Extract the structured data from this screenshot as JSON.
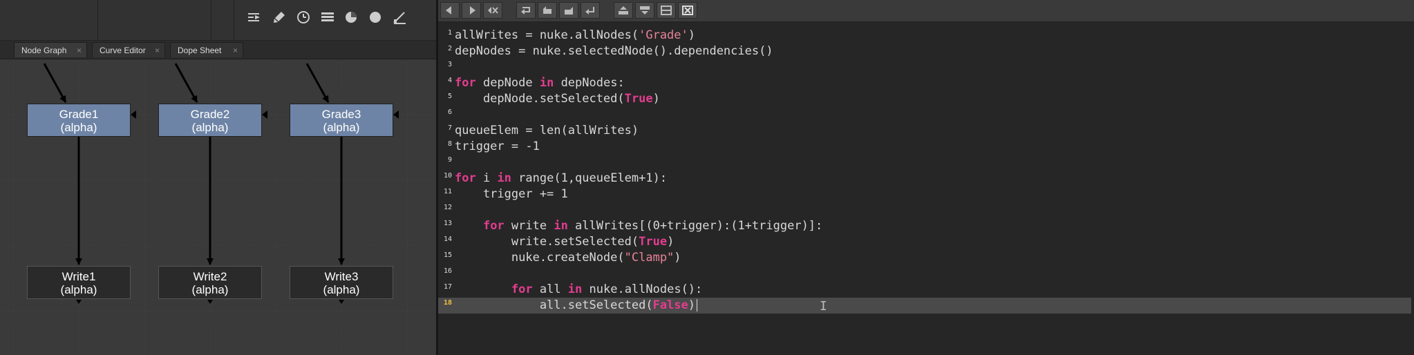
{
  "node_graph_toolbar": {
    "icons": [
      "script-editor-icon",
      "brush-icon",
      "clock-icon",
      "list-icon",
      "pie-icon",
      "circle-icon",
      "probe-icon"
    ]
  },
  "tabs": [
    {
      "label": "Node Graph",
      "close": "×"
    },
    {
      "label": "Curve Editor",
      "close": "×"
    },
    {
      "label": "Dope Sheet",
      "close": "×"
    }
  ],
  "nodes": {
    "grade1": {
      "name": "Grade1",
      "sub": "(alpha)"
    },
    "grade2": {
      "name": "Grade2",
      "sub": "(alpha)"
    },
    "grade3": {
      "name": "Grade3",
      "sub": "(alpha)"
    },
    "write1": {
      "name": "Write1",
      "sub": "(alpha)"
    },
    "write2": {
      "name": "Write2",
      "sub": "(alpha)"
    },
    "write3": {
      "name": "Write3",
      "sub": "(alpha)"
    }
  },
  "script_toolbar": {
    "buttons": [
      "previous-script-icon",
      "next-script-icon",
      "clear-history-icon",
      "source-script-icon",
      "load-script-icon",
      "save-script-icon",
      "run-script-icon",
      "show-input-icon",
      "show-output-icon",
      "show-both-icon",
      "clear-output-icon"
    ]
  },
  "code": {
    "current_line": 18,
    "lines": [
      {
        "n": "1",
        "tokens": [
          [
            "",
            "allWrites = nuke.allNodes("
          ],
          [
            "str",
            "'Grade'"
          ],
          [
            "",
            ")"
          ]
        ]
      },
      {
        "n": "2",
        "tokens": [
          [
            "",
            "depNodes = nuke.selectedNode().dependencies()"
          ]
        ]
      },
      {
        "n": "3",
        "tokens": []
      },
      {
        "n": "4",
        "tokens": [
          [
            "kw",
            "for"
          ],
          [
            "",
            " depNode "
          ],
          [
            "kw",
            "in"
          ],
          [
            "",
            " depNodes:"
          ]
        ]
      },
      {
        "n": "5",
        "tokens": [
          [
            "",
            "    depNode.setSelected("
          ],
          [
            "kw",
            "True"
          ],
          [
            "",
            ")"
          ]
        ]
      },
      {
        "n": "6",
        "tokens": []
      },
      {
        "n": "7",
        "tokens": [
          [
            "",
            "queueElem = len(allWrites)"
          ]
        ]
      },
      {
        "n": "8",
        "tokens": [
          [
            "",
            "trigger = -1"
          ]
        ]
      },
      {
        "n": "9",
        "tokens": []
      },
      {
        "n": "10",
        "tokens": [
          [
            "kw",
            "for"
          ],
          [
            "",
            " i "
          ],
          [
            "kw",
            "in"
          ],
          [
            "",
            " range(1,queueElem+1):"
          ]
        ]
      },
      {
        "n": "11",
        "tokens": [
          [
            "",
            "    trigger += 1"
          ]
        ]
      },
      {
        "n": "12",
        "tokens": []
      },
      {
        "n": "13",
        "tokens": [
          [
            "",
            "    "
          ],
          [
            "kw",
            "for"
          ],
          [
            "",
            " write "
          ],
          [
            "kw",
            "in"
          ],
          [
            "",
            " allWrites[(0+trigger):(1+trigger)]:"
          ]
        ]
      },
      {
        "n": "14",
        "tokens": [
          [
            "",
            "        write.setSelected("
          ],
          [
            "kw",
            "True"
          ],
          [
            "",
            ")"
          ]
        ]
      },
      {
        "n": "15",
        "tokens": [
          [
            "",
            "        nuke.createNode("
          ],
          [
            "str",
            "\"Clamp\""
          ],
          [
            "",
            ")"
          ]
        ]
      },
      {
        "n": "16",
        "tokens": []
      },
      {
        "n": "17",
        "tokens": [
          [
            "",
            "        "
          ],
          [
            "kw",
            "for"
          ],
          [
            "",
            " all "
          ],
          [
            "kw",
            "in"
          ],
          [
            "",
            " nuke.allNodes():"
          ]
        ]
      },
      {
        "n": "18",
        "tokens": [
          [
            "",
            "            all.setSelected("
          ],
          [
            "kw",
            "False"
          ],
          [
            "",
            ")"
          ]
        ]
      }
    ]
  }
}
